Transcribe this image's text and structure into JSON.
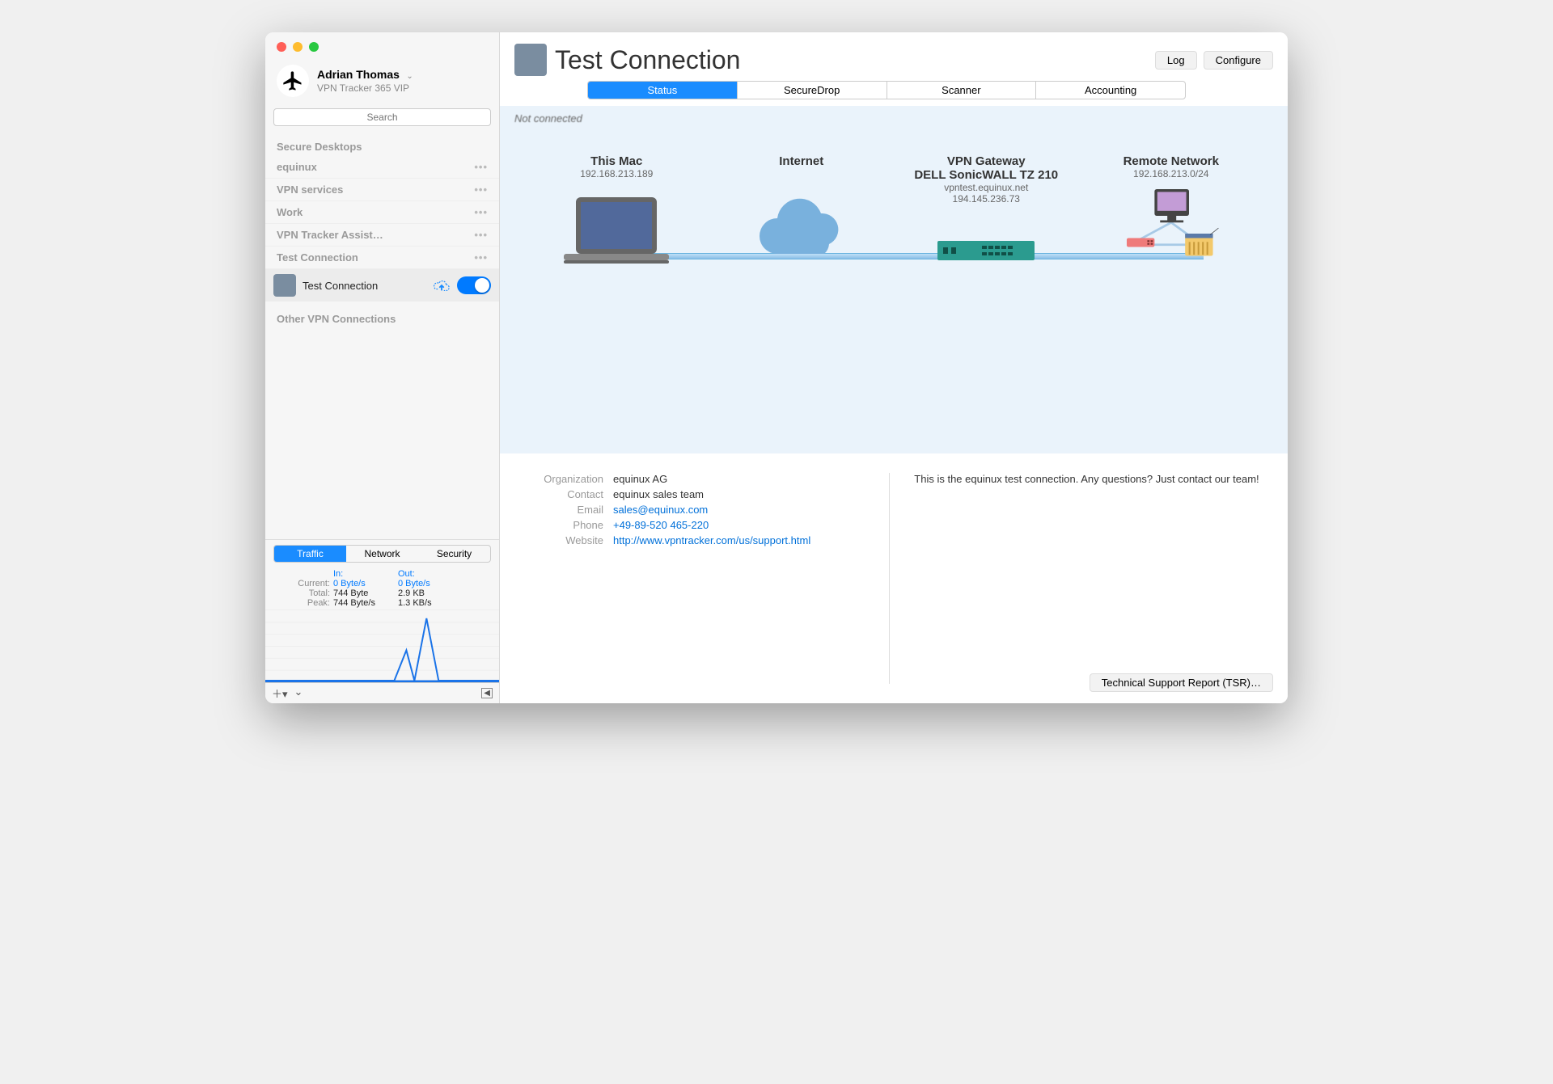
{
  "user": {
    "name": "Adrian Thomas",
    "plan": "VPN Tracker 365 VIP"
  },
  "search": {
    "placeholder": "Search"
  },
  "sidebar": {
    "sections": [
      {
        "label": "Secure Desktops"
      }
    ],
    "items": [
      {
        "label": "equinux"
      },
      {
        "label": "VPN services"
      },
      {
        "label": "Work"
      },
      {
        "label": "VPN Tracker Assist…"
      },
      {
        "label": "Test Connection"
      }
    ],
    "connection": {
      "label": "Test Connection"
    },
    "other_label": "Other VPN Connections"
  },
  "bottom_tabs": {
    "t0": "Traffic",
    "t1": "Network",
    "t2": "Security"
  },
  "traffic": {
    "in_label": "In:",
    "out_label": "Out:",
    "current_label": "Current:",
    "current_in": "0 Byte/s",
    "current_out": "0 Byte/s",
    "total_label": "Total:",
    "total_in": "744 Byte",
    "total_out": "2.9 KB",
    "peak_label": "Peak:",
    "peak_in": "744 Byte/s",
    "peak_out": "1.3 KB/s"
  },
  "header": {
    "title": "Test Connection",
    "btn_log": "Log",
    "btn_configure": "Configure",
    "tabs": {
      "t0": "Status",
      "t1": "SecureDrop",
      "t2": "Scanner",
      "t3": "Accounting"
    }
  },
  "status_text": "Not connected",
  "nodes": {
    "mac": {
      "title": "This Mac",
      "sub1": "192.168.213.189"
    },
    "internet": {
      "title": "Internet"
    },
    "gateway": {
      "title": "VPN Gateway",
      "sub1": "DELL SonicWALL TZ 210",
      "sub2": "vpntest.equinux.net",
      "sub3": "194.145.236.73"
    },
    "remote": {
      "title": "Remote Network",
      "sub1": "192.168.213.0/24"
    }
  },
  "info": {
    "org_label": "Organization",
    "org": "equinux AG",
    "contact_label": "Contact",
    "contact": "equinux sales team",
    "email_label": "Email",
    "email": "sales@equinux.com",
    "phone_label": "Phone",
    "phone": "+49-89-520 465-220",
    "website_label": "Website",
    "website": "http://www.vpntracker.com/us/support.html",
    "note": "This is the equinux test connection. Any questions? Just contact our team!"
  },
  "tsr_button": "Technical Support Report (TSR)…"
}
